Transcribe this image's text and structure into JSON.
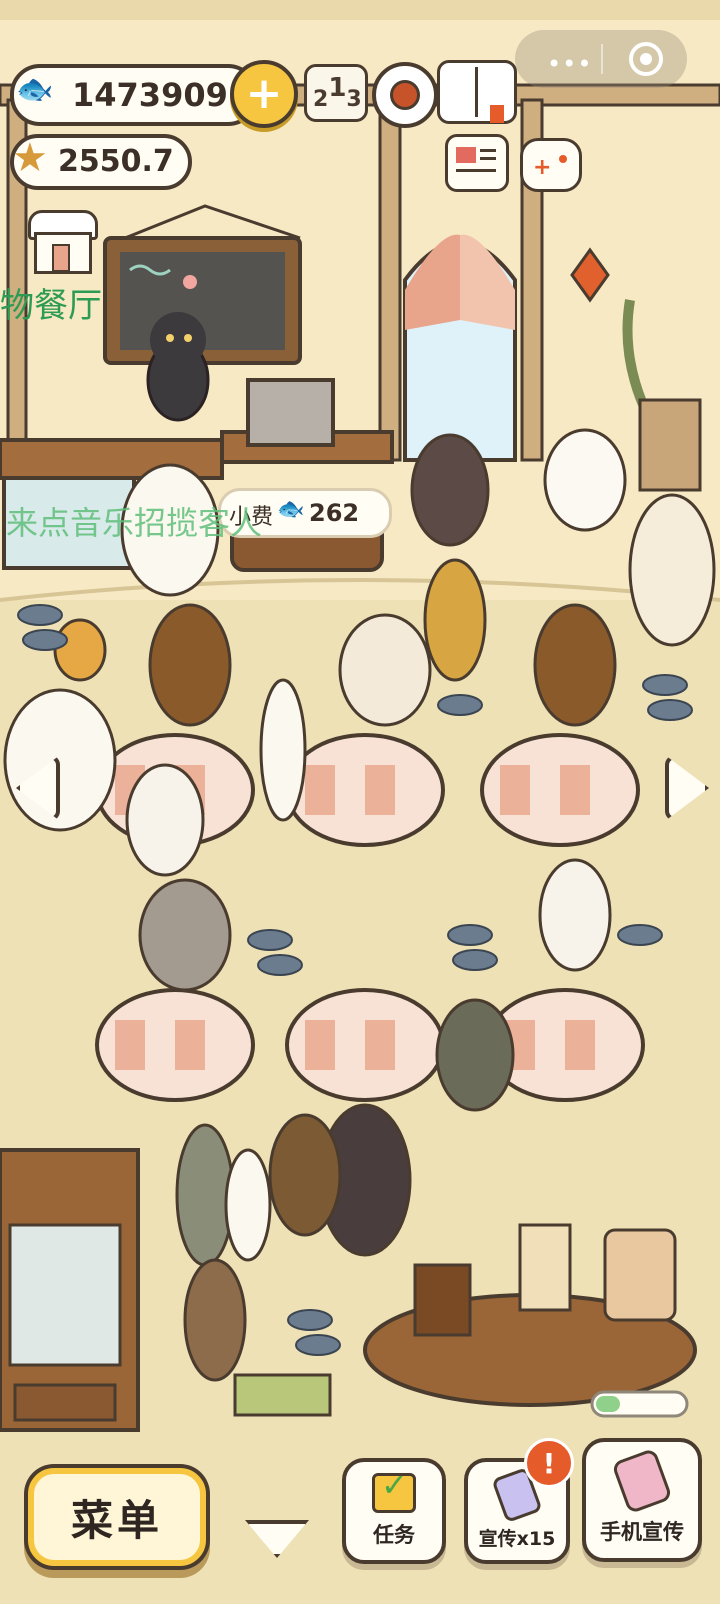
{
  "hud": {
    "fish_count": "1473909",
    "star_count": "2550.7",
    "restaurant_name_partial": "物餐厅",
    "tip_label": "小费",
    "tip_value": "262",
    "scroll_message": "来点音乐招揽客人"
  },
  "buttons": {
    "menu": "菜单",
    "tasks": "任务",
    "promote": "宣传x15",
    "phone_promote": "手机宣传",
    "alert_mark": "!"
  },
  "icons": [
    "fish-icon",
    "plus-icon",
    "ranking-icon",
    "gear-icon",
    "book-icon",
    "newspaper-icon",
    "gamepad-icon",
    "star-icon",
    "shop-icon",
    "arrow-left-icon",
    "arrow-right-icon",
    "chevron-down-icon",
    "checkbox-icon",
    "phone-icon"
  ],
  "colors": {
    "background": "#efe2b8",
    "wall": "#f4e6bf",
    "beam": "#c8a67a",
    "table_check": "#e9a58b",
    "outline": "#4a3b2f",
    "gold": "#f6c640",
    "alert": "#e55b2a",
    "green_text": "#2e9b54"
  }
}
